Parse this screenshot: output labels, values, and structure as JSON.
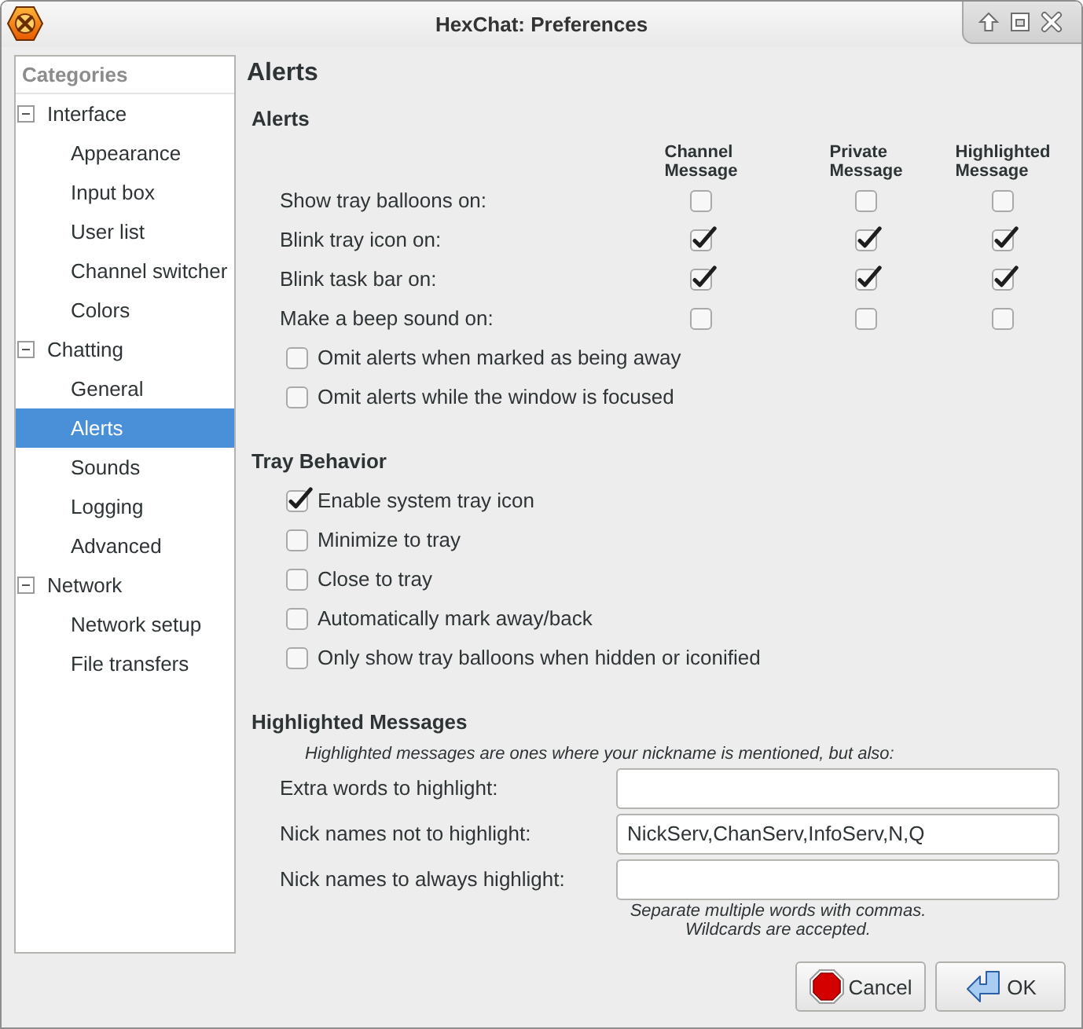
{
  "window": {
    "title": "HexChat: Preferences"
  },
  "sidebar": {
    "header": "Categories",
    "items": [
      {
        "label": "Interface",
        "expanded": true,
        "selected": false,
        "children": [
          {
            "label": "Appearance",
            "selected": false
          },
          {
            "label": "Input box",
            "selected": false
          },
          {
            "label": "User list",
            "selected": false
          },
          {
            "label": "Channel switcher",
            "selected": false
          },
          {
            "label": "Colors",
            "selected": false
          }
        ]
      },
      {
        "label": "Chatting",
        "expanded": true,
        "selected": false,
        "children": [
          {
            "label": "General",
            "selected": false
          },
          {
            "label": "Alerts",
            "selected": true
          },
          {
            "label": "Sounds",
            "selected": false
          },
          {
            "label": "Logging",
            "selected": false
          },
          {
            "label": "Advanced",
            "selected": false
          }
        ]
      },
      {
        "label": "Network",
        "expanded": true,
        "selected": false,
        "children": [
          {
            "label": "Network setup",
            "selected": false
          },
          {
            "label": "File transfers",
            "selected": false
          }
        ]
      }
    ]
  },
  "page": {
    "title": "Alerts",
    "sections": [
      {
        "kind": "matrix",
        "title": "Alerts",
        "columns": [
          "Channel Message",
          "Private Message",
          "Highlighted Message"
        ],
        "rows": [
          {
            "label": "Show tray balloons on:",
            "cells": [
              {
                "checked": false
              },
              {
                "checked": false
              },
              {
                "checked": false
              }
            ]
          },
          {
            "label": "Blink tray icon on:",
            "cells": [
              {
                "checked": true
              },
              {
                "checked": true
              },
              {
                "checked": true
              }
            ]
          },
          {
            "label": "Blink task bar on:",
            "cells": [
              {
                "checked": true
              },
              {
                "checked": true
              },
              {
                "checked": true
              }
            ]
          },
          {
            "label": "Make a beep sound on:",
            "cells": [
              {
                "checked": false
              },
              {
                "checked": false
              },
              {
                "checked": false
              }
            ]
          }
        ],
        "options": [
          {
            "label": "Omit alerts when marked as being away",
            "checked": false
          },
          {
            "label": "Omit alerts while the window is focused",
            "checked": false
          }
        ]
      },
      {
        "kind": "checklist",
        "title": "Tray Behavior",
        "options": [
          {
            "label": "Enable system tray icon",
            "checked": true
          },
          {
            "label": "Minimize to tray",
            "checked": false
          },
          {
            "label": "Close to tray",
            "checked": false
          },
          {
            "label": "Automatically mark away/back",
            "checked": false
          },
          {
            "label": "Only show tray balloons when hidden or iconified",
            "checked": false
          }
        ]
      },
      {
        "kind": "fields",
        "title": "Highlighted Messages",
        "note": "Highlighted messages are ones where your nickname is mentioned, but also:",
        "fields": [
          {
            "label": "Extra words to highlight:"
          },
          {
            "label": "Nick names not to highlight:",
            "value": "NickServ,ChanServ,InfoServ,N,Q"
          },
          {
            "label": "Nick names to always highlight:"
          }
        ],
        "hint": "Separate multiple words with commas.\nWildcards are accepted."
      }
    ]
  },
  "buttons": [
    {
      "kind": "cancel",
      "label": "Cancel"
    },
    {
      "kind": "ok",
      "label": "OK"
    }
  ]
}
